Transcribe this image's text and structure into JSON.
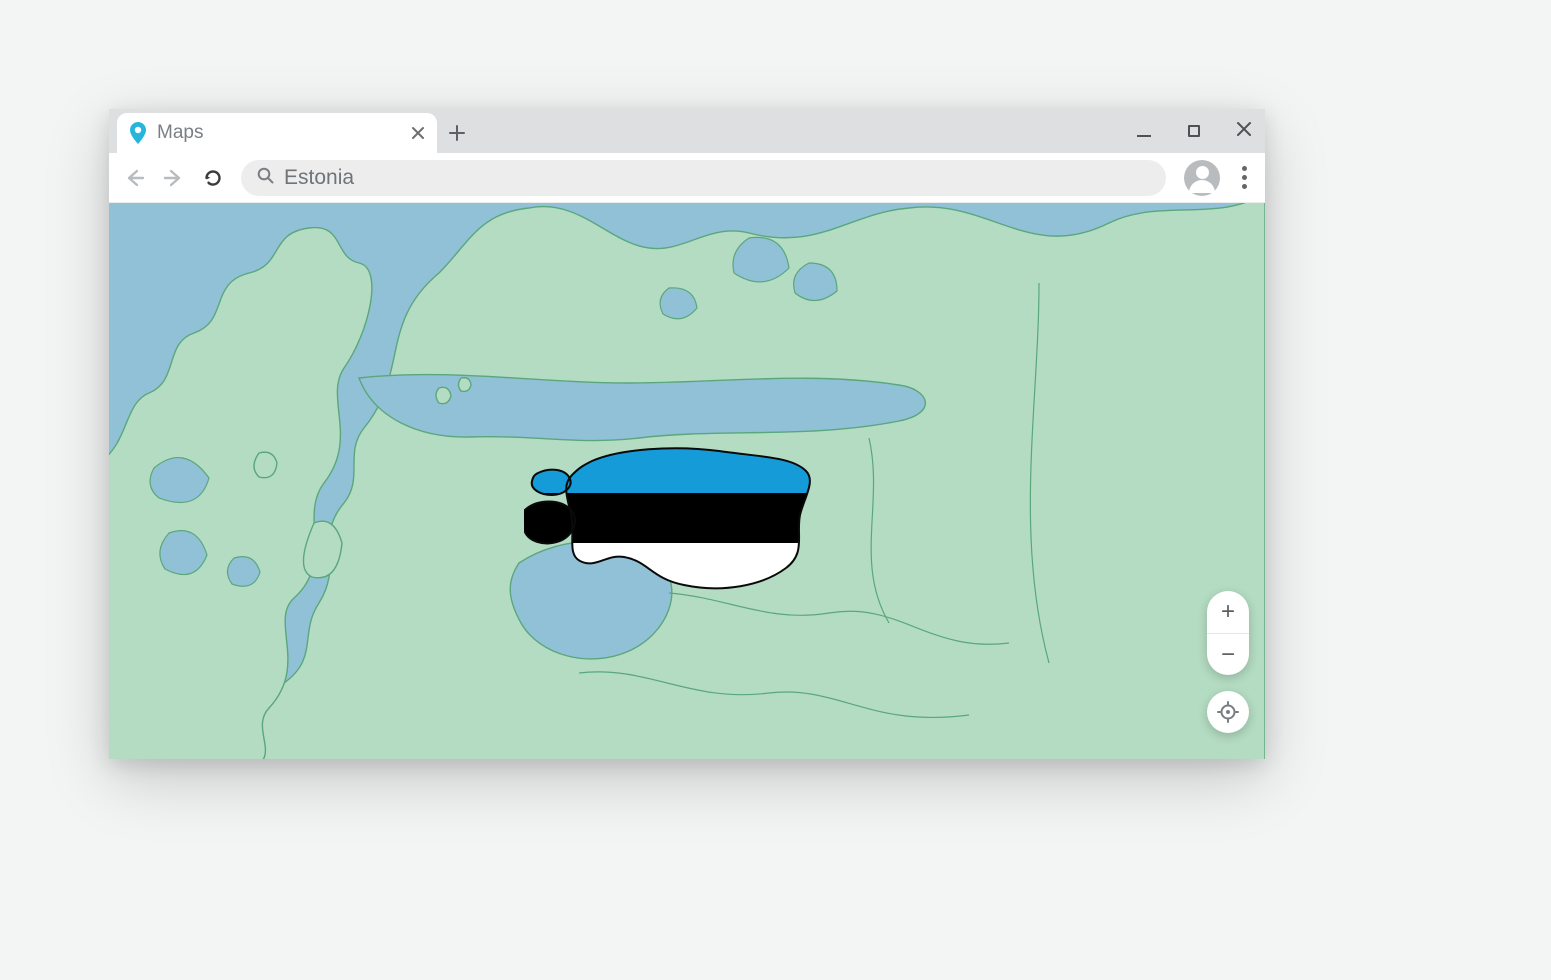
{
  "tab": {
    "title": "Maps"
  },
  "search": {
    "value": "Estonia",
    "placeholder": ""
  },
  "map": {
    "highlighted_country": "Estonia",
    "flag_colors": {
      "top": "#159cd8",
      "middle": "#000000",
      "bottom": "#ffffff"
    },
    "water_color": "#91c1d6",
    "land_color": "#b4dcc2",
    "border_color": "#5aa77c"
  },
  "controls": {
    "zoom_in": "+",
    "zoom_out": "−"
  }
}
